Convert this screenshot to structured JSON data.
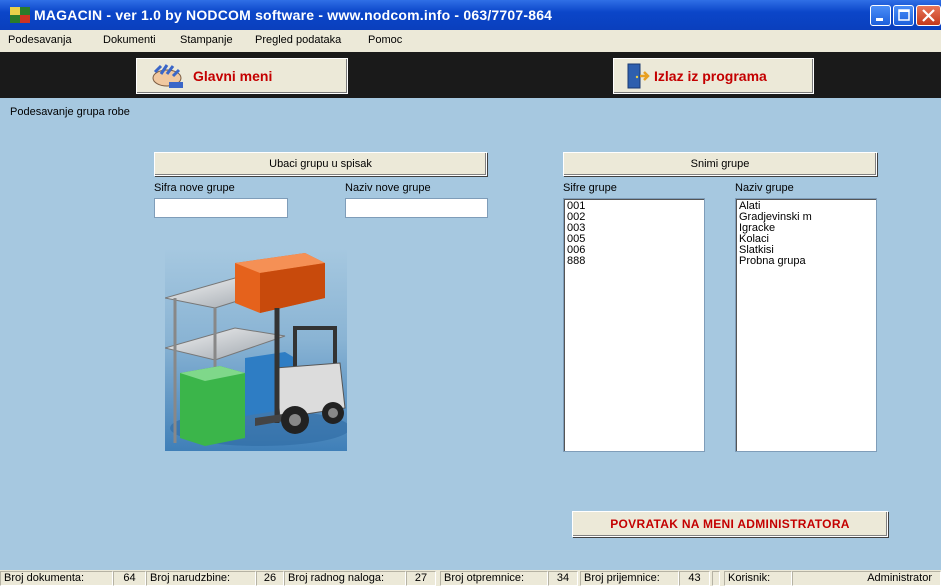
{
  "window": {
    "title": "MAGACIN - ver 1.0 by NODCOM software - www.nodcom.info - 063/7707-864"
  },
  "menu": [
    {
      "label": "Podesavanja"
    },
    {
      "label": "Dokumenti"
    },
    {
      "label": "Stampanje"
    },
    {
      "label": "Pregled podataka"
    },
    {
      "label": "Pomoc"
    }
  ],
  "toolbar": {
    "main_menu": "Glavni meni",
    "exit": "Izlaz iz programa"
  },
  "page": {
    "title": "Podesavanje grupa robe"
  },
  "form": {
    "add_button": "Ubaci grupu u spisak",
    "save_button": "Snimi grupe",
    "code_label": "Sifra nove grupe",
    "name_label": "Naziv nove grupe",
    "code_value": "",
    "name_value": "",
    "codes_label": "Sifre grupe",
    "names_label": "Naziv grupe",
    "codes": [
      "001",
      "002",
      "003",
      "005",
      "006",
      "888"
    ],
    "names": [
      "Alati",
      "Gradjevinski m",
      "Igracke",
      "Kolaci",
      "Slatkisi",
      "Probna grupa"
    ],
    "back_button": "POVRATAK NA MENI ADMINISTRATORA"
  },
  "status": {
    "doc_label": "Broj dokumenta:",
    "doc_value": "64",
    "order_label": "Broj narudzbine:",
    "order_value": "26",
    "work_label": "Broj radnog naloga:",
    "work_value": "27",
    "dispatch_label": "Broj otpremnice:",
    "dispatch_value": "34",
    "receipt_label": "Broj prijemnice:",
    "receipt_value": "43",
    "user_label": "Korisnik:",
    "user_value": "Administrator"
  },
  "colors": {
    "background": "#a6c8e0",
    "accent_text": "#c40000",
    "titlebar": "#0b46c9"
  },
  "icons": [
    "app-icon",
    "hand-icon",
    "door-exit-icon",
    "forklift-illustration"
  ]
}
